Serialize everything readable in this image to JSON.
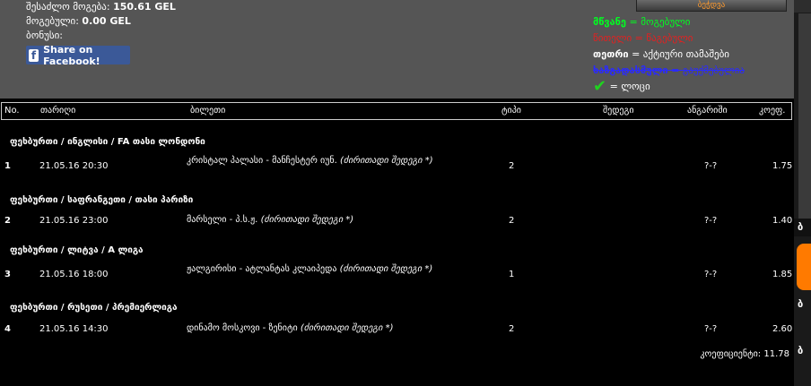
{
  "summary": {
    "possible_win_label": "შესაძლო მოგება:",
    "possible_win_value": "150.61 GEL",
    "won_label": "მოგებული:",
    "won_value": "0.00 GEL",
    "bonus_label": "ბონუსი:"
  },
  "facebook": {
    "label": "Share on Facebook!",
    "icon": "f"
  },
  "print_button": {
    "label": "ბეჭდვა"
  },
  "legend": {
    "green_key": "მწვანე",
    "green_val": "მოგებული",
    "red_text": "წითელი = წაგებული",
    "white_key": "თეთრი",
    "white_val": "აქტიური თამაშები",
    "blue_key": "ხაზგადასმული",
    "blue_val": "გაუქმებულია",
    "check_val": "ლოცი"
  },
  "colors": {
    "green": "#00ff21",
    "red": "#e42020",
    "blue": "#2a2aff",
    "facebook": "#3b5998"
  },
  "table": {
    "headers": [
      "No.",
      "თარიღი",
      "ბილეთი",
      "ტიპი",
      "შედეგი",
      "ანგარიში",
      "კოეფ."
    ],
    "sections": [
      {
        "title": "ფეხბურთი / ინგლისი / FA თასი ლონდონი",
        "num": "1",
        "date": "21.05.16 20:30",
        "match": "კრისტალ პალასი - მანჩესტერ იუნ.",
        "note": "(ძირითადი შედეგი *)",
        "type": "2",
        "score": "?-?",
        "coef": "1.75"
      },
      {
        "title": "ფეხბურთი / საფრანგეთი / თასი პარიზი",
        "num": "2",
        "date": "21.05.16 23:00",
        "match": "მარსელი - პ.ს.ჟ.",
        "note": "(ძირითადი შედეგი *)",
        "type": "2",
        "score": "?-?",
        "coef": "1.40"
      },
      {
        "title": "ფეხბურთი / ლიტვა / A ლიგა",
        "num": "3",
        "date": "21.05.16 18:00",
        "match": "ჟალგირისი - ატლანტას კლაიპედა",
        "note": "(ძირითადი შედეგი *)",
        "type": "1",
        "score": "?-?",
        "coef": "1.85"
      },
      {
        "title": "ფეხბურთი / რუსეთი / პრემიერლიგა",
        "num": "4",
        "date": "21.05.16 14:30",
        "match": "დინამო მოსკოვი - ზენიტი",
        "note": "(ძირითადი შედეგი *)",
        "type": "2",
        "score": "?-?",
        "coef": "2.60"
      }
    ],
    "total_label": "კოეფიციენტი:",
    "total_value": "11.78"
  }
}
